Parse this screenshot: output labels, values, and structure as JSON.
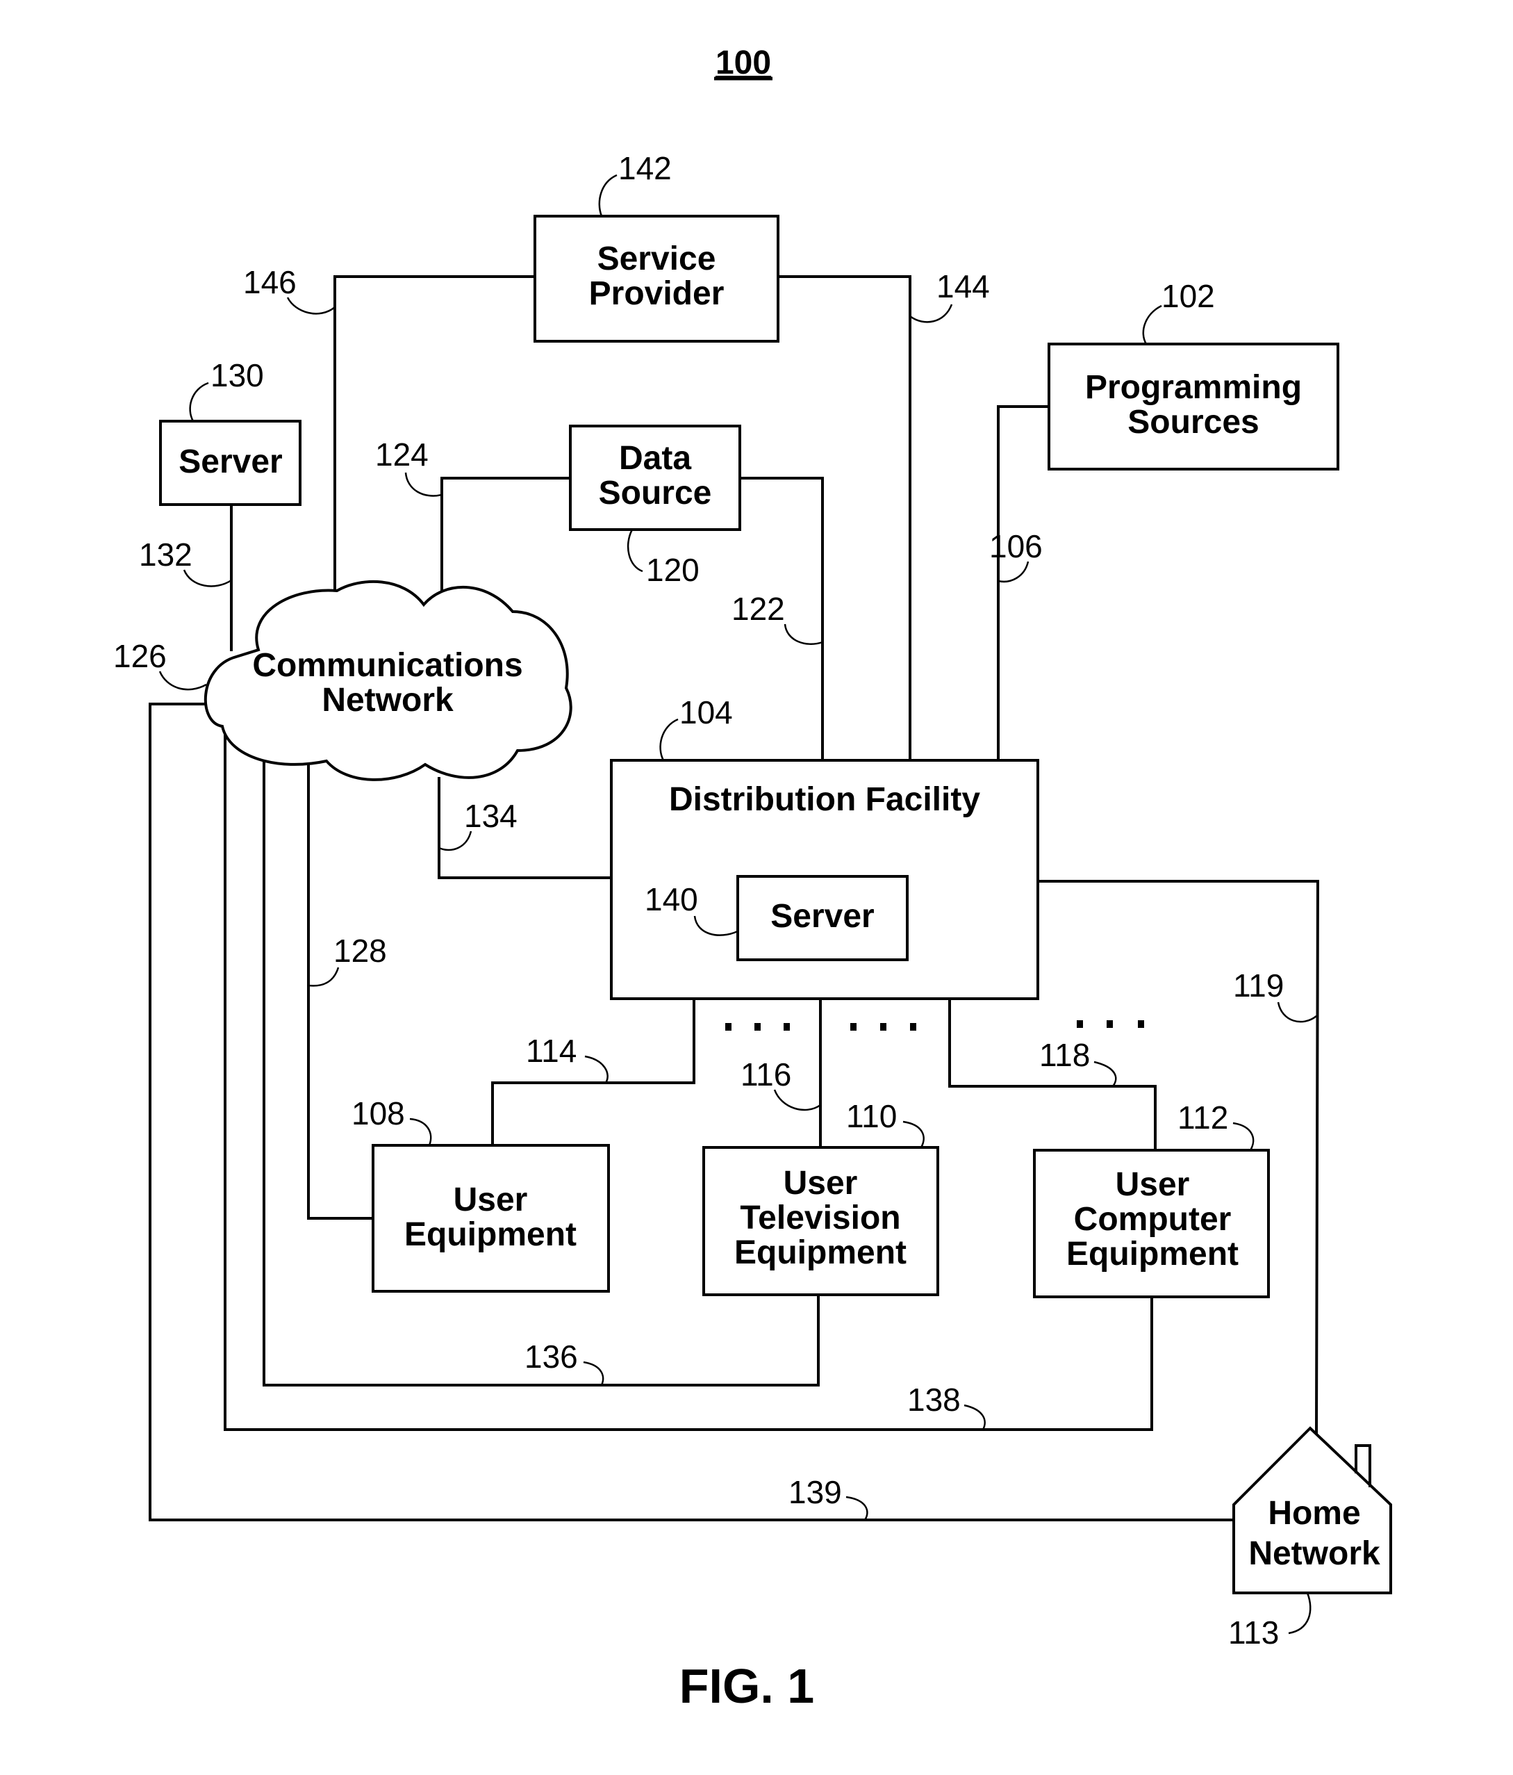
{
  "figure": {
    "number": "100",
    "caption": "FIG. 1"
  },
  "nodes": {
    "service_provider": {
      "lines": [
        "Service",
        "Provider"
      ],
      "ref": "142"
    },
    "programming_sources": {
      "lines": [
        "Programming",
        "Sources"
      ],
      "ref": "102"
    },
    "server_130": {
      "lines": [
        "Server"
      ],
      "ref": "130"
    },
    "data_source": {
      "lines": [
        "Data",
        "Source"
      ],
      "ref": "120"
    },
    "communications_network": {
      "lines": [
        "Communications",
        "Network"
      ]
    },
    "distribution_facility": {
      "lines": [
        "Distribution Facility"
      ],
      "ref": "104"
    },
    "server_140": {
      "lines": [
        "Server"
      ],
      "ref": "140"
    },
    "user_equipment": {
      "lines": [
        "User",
        "Equipment"
      ],
      "ref": "108"
    },
    "user_television_equipment": {
      "lines": [
        "User",
        "Television",
        "Equipment"
      ],
      "ref": "110"
    },
    "user_computer_equipment": {
      "lines": [
        "User",
        "Computer",
        "Equipment"
      ],
      "ref": "112"
    },
    "home_network": {
      "lines": [
        "Home",
        "Network"
      ],
      "ref": "113"
    }
  },
  "links": {
    "l146": "146",
    "l144": "144",
    "l106": "106",
    "l132": "132",
    "l124": "124",
    "l122": "122",
    "l126": "126",
    "l134": "134",
    "l128": "128",
    "l114": "114",
    "l116": "116",
    "l118": "118",
    "l119": "119",
    "l136": "136",
    "l138": "138",
    "l139": "139"
  }
}
